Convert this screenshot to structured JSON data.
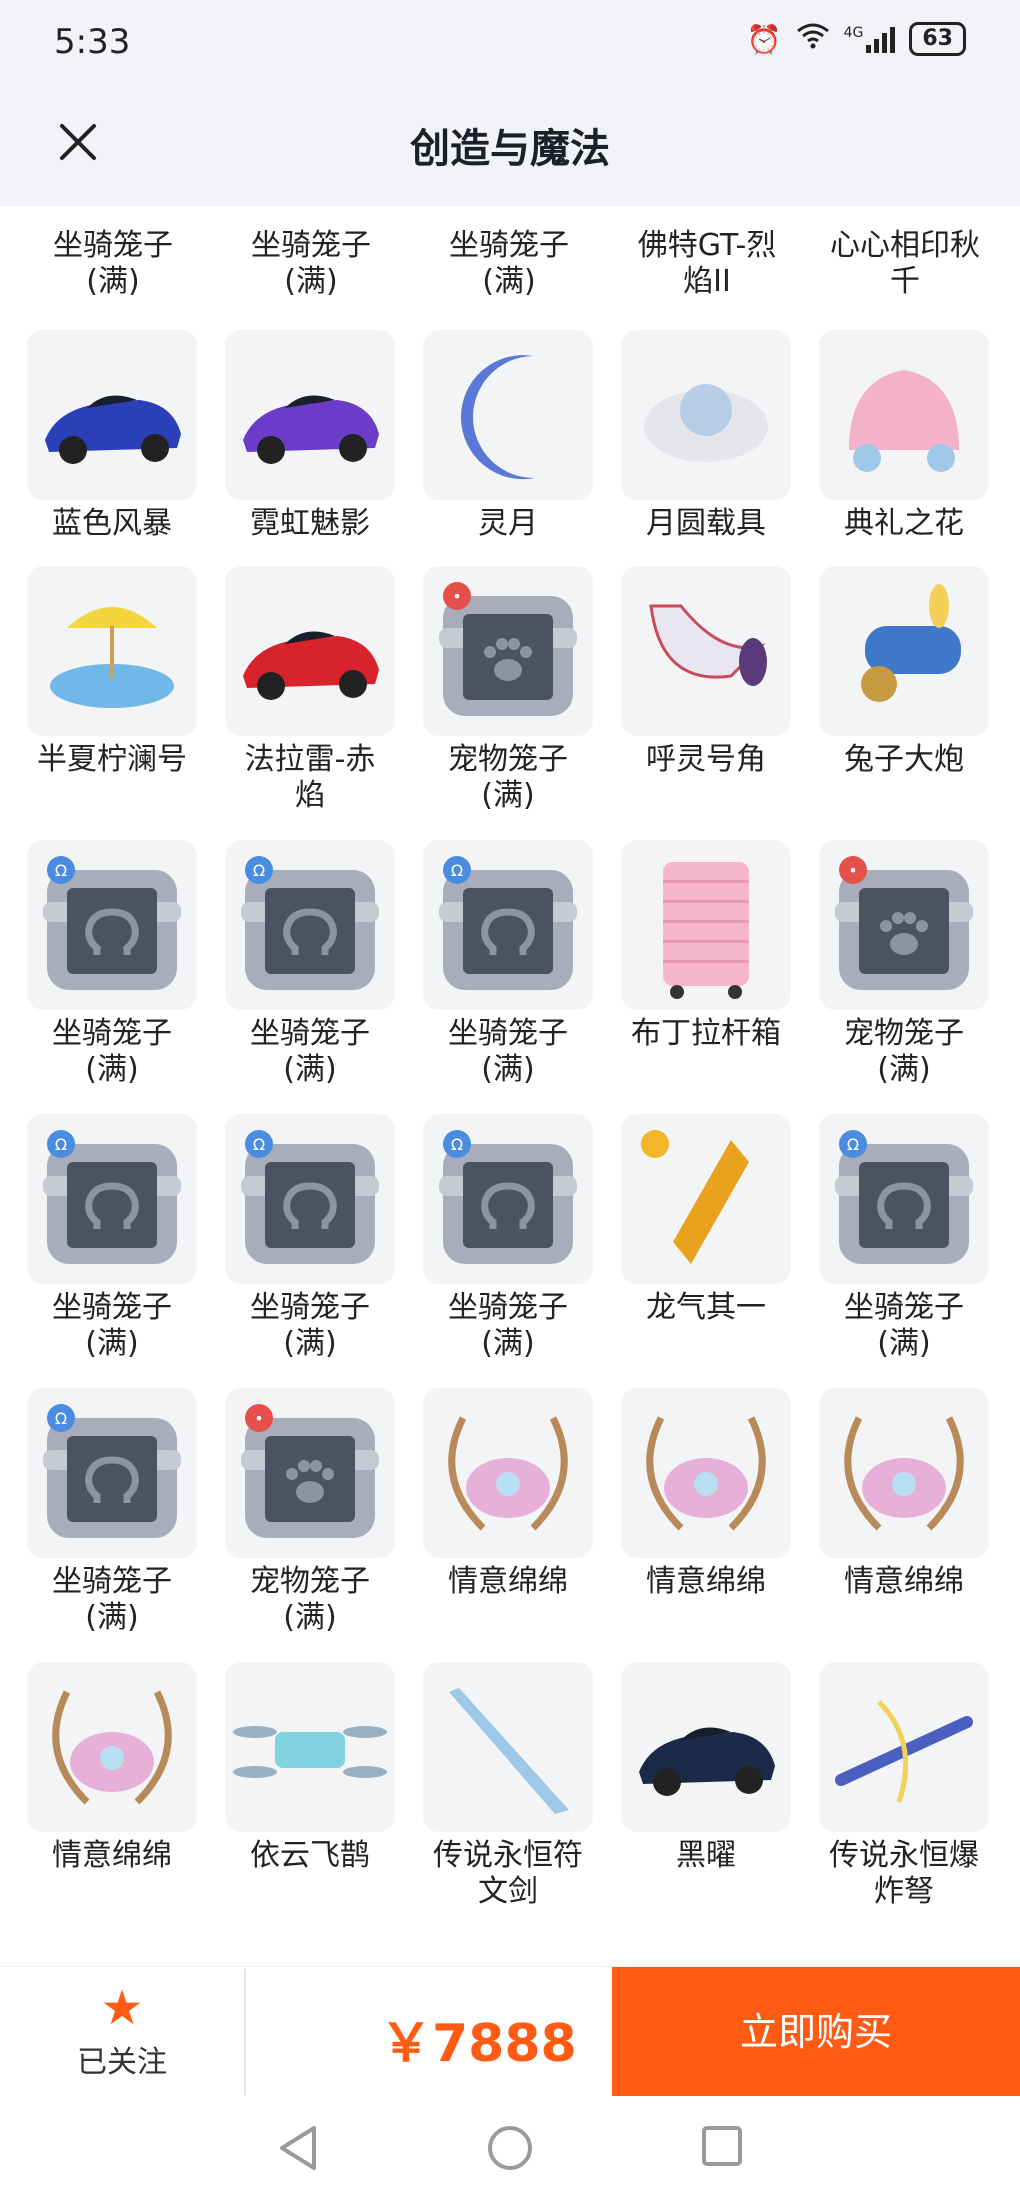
{
  "status_bar": {
    "time": "5:33",
    "network": "4G",
    "signal_label": "6",
    "battery": "63"
  },
  "header": {
    "title": "创造与魔法"
  },
  "top_row_labels": [
    "坐骑笼子\n(满)",
    "坐骑笼子\n(满)",
    "坐骑笼子\n(满)",
    "佛特GT-烈\n焰II",
    "心心相印秋\n千"
  ],
  "rows": [
    [
      {
        "label": "蓝色风暴",
        "icon": "blue-racecar-icon",
        "kind": "car",
        "color": "#2a3fb8"
      },
      {
        "label": "霓虹魅影",
        "icon": "neon-racecar-icon",
        "kind": "car",
        "color": "#6a3cc8"
      },
      {
        "label": "灵月",
        "icon": "crescent-moon-icon",
        "kind": "moon",
        "color": "#5a78d8"
      },
      {
        "label": "月圆载具",
        "icon": "full-moon-vehicle-icon",
        "kind": "cloud",
        "color": "#b8cde8"
      },
      {
        "label": "典礼之花",
        "icon": "flower-carriage-icon",
        "kind": "carriage",
        "color": "#f2a6c2"
      }
    ],
    [
      {
        "label": "半夏柠澜号",
        "icon": "lemon-float-icon",
        "kind": "float",
        "color": "#f5d53d"
      },
      {
        "label": "法拉雷-赤\n焰",
        "icon": "red-sportscar-icon",
        "kind": "car",
        "color": "#d8222c"
      },
      {
        "label": "宠物笼子\n(满)",
        "icon": "pet-cage-icon",
        "kind": "pet-cage",
        "color": "#5b6272"
      },
      {
        "label": "呼灵号角",
        "icon": "spirit-horn-icon",
        "kind": "horn",
        "color": "#e8e6f0"
      },
      {
        "label": "兔子大炮",
        "icon": "rabbit-cannon-icon",
        "kind": "cannon",
        "color": "#3f78c8"
      }
    ],
    [
      {
        "label": "坐骑笼子\n(满)",
        "icon": "mount-cage-icon",
        "kind": "mount-cage",
        "color": "#5b6272"
      },
      {
        "label": "坐骑笼子\n(满)",
        "icon": "mount-cage-icon",
        "kind": "mount-cage",
        "color": "#5b6272"
      },
      {
        "label": "坐骑笼子\n(满)",
        "icon": "mount-cage-icon",
        "kind": "mount-cage",
        "color": "#5b6272"
      },
      {
        "label": "布丁拉杆箱",
        "icon": "pink-suitcase-icon",
        "kind": "suitcase",
        "color": "#f6b6cc"
      },
      {
        "label": "宠物笼子\n(满)",
        "icon": "pet-cage-icon",
        "kind": "pet-cage",
        "color": "#5b6272"
      }
    ],
    [
      {
        "label": "坐骑笼子\n(满)",
        "icon": "mount-cage-icon",
        "kind": "mount-cage",
        "color": "#5b6272"
      },
      {
        "label": "坐骑笼子\n(满)",
        "icon": "mount-cage-icon",
        "kind": "mount-cage",
        "color": "#5b6272"
      },
      {
        "label": "坐骑笼子\n(满)",
        "icon": "mount-cage-icon",
        "kind": "mount-cage",
        "color": "#5b6272"
      },
      {
        "label": "龙气其一",
        "icon": "dragon-crystal-icon",
        "kind": "crystal",
        "color": "#e9a21e"
      },
      {
        "label": "坐骑笼子\n(满)",
        "icon": "mount-cage-icon",
        "kind": "mount-cage",
        "color": "#5b6272"
      }
    ],
    [
      {
        "label": "坐骑笼子\n(满)",
        "icon": "mount-cage-icon",
        "kind": "mount-cage",
        "color": "#5b6272"
      },
      {
        "label": "宠物笼子\n(满)",
        "icon": "pet-cage-icon",
        "kind": "pet-cage",
        "color": "#5b6272"
      },
      {
        "label": "情意绵绵",
        "icon": "bow-wings-icon",
        "kind": "bow",
        "color": "#e6b0d8"
      },
      {
        "label": "情意绵绵",
        "icon": "bow-wings-icon",
        "kind": "bow",
        "color": "#e6b0d8"
      },
      {
        "label": "情意绵绵",
        "icon": "bow-wings-icon",
        "kind": "bow",
        "color": "#e6b0d8"
      }
    ],
    [
      {
        "label": "情意绵绵",
        "icon": "bow-wings-icon",
        "kind": "bow",
        "color": "#e6b0d8"
      },
      {
        "label": "依云飞鹊",
        "icon": "drone-icon",
        "kind": "drone",
        "color": "#7fd4e0"
      },
      {
        "label": "传说永恒符\n文剑",
        "icon": "rune-sword-icon",
        "kind": "sword",
        "color": "#9ec8e8"
      },
      {
        "label": "黑曜",
        "icon": "black-classic-car-icon",
        "kind": "car",
        "color": "#1c2a4a"
      },
      {
        "label": "传说永恒爆\n炸弩",
        "icon": "crossbow-icon",
        "kind": "crossbow",
        "color": "#4a5fc0"
      }
    ]
  ],
  "bottom_bar": {
    "follow_label": "已关注",
    "price": "￥7888",
    "buy_label": "立即购买"
  },
  "colors": {
    "accent": "#ff5b14",
    "tile_bg": "#f3f4f6",
    "header_bg": "#f1f3f7"
  }
}
